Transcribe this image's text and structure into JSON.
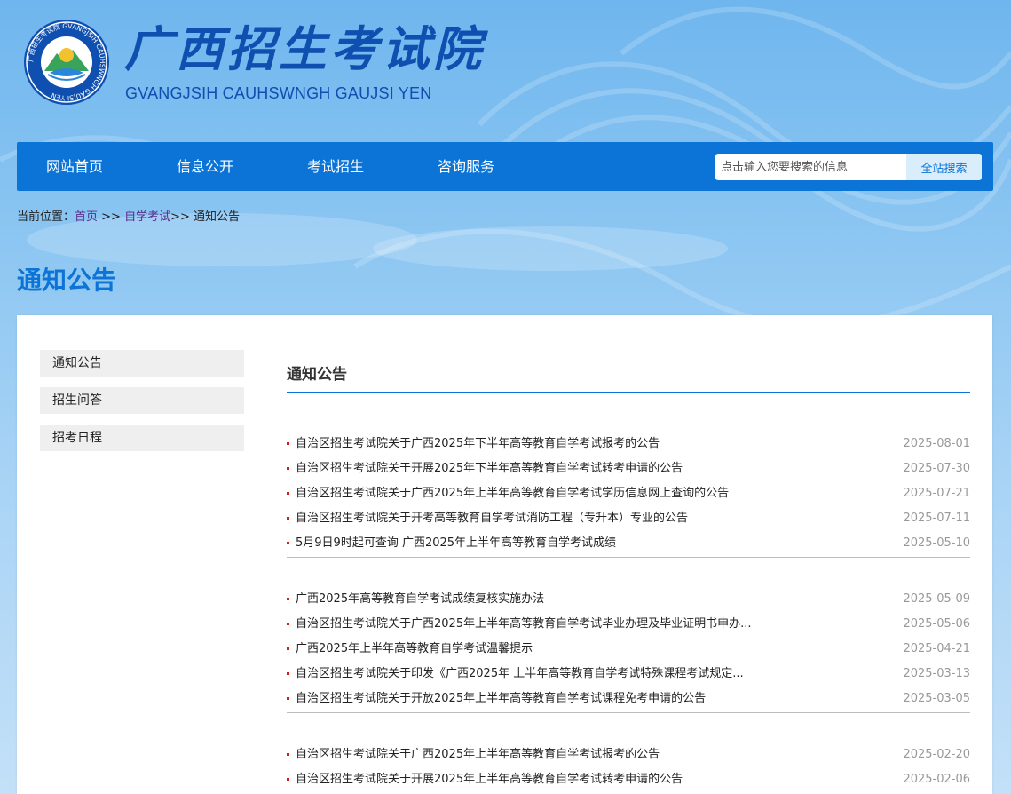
{
  "header": {
    "brand_cn": "广西招生考试院",
    "brand_en": "GVANGJSIH CAUHSWNGH GAUJSI YEN",
    "logo_ring_text": "广西招生考试院 GVANGJSIH CAUHSWNGH GAUJSI YEN"
  },
  "nav": {
    "items": [
      {
        "label": "网站首页"
      },
      {
        "label": "信息公开"
      },
      {
        "label": "考试招生"
      },
      {
        "label": "咨询服务"
      }
    ],
    "search_placeholder": "点击输入您要搜索的信息",
    "search_button": "全站搜索"
  },
  "breadcrumb": {
    "prefix": "当前位置：",
    "home": "首页",
    "sep1": " >> ",
    "category": "自学考试",
    "sep2": ">> ",
    "current": "通知公告"
  },
  "page_title": "通知公告",
  "sidebar": {
    "items": [
      {
        "label": "通知公告"
      },
      {
        "label": "招生问答"
      },
      {
        "label": "招考日程"
      }
    ]
  },
  "main": {
    "title": "通知公告",
    "groups": [
      {
        "items": [
          {
            "title": "自治区招生考试院关于广西2025年下半年高等教育自学考试报考的公告",
            "date": "2025-08-01"
          },
          {
            "title": "自治区招生考试院关于开展2025年下半年高等教育自学考试转考申请的公告",
            "date": "2025-07-30"
          },
          {
            "title": "自治区招生考试院关于广西2025年上半年高等教育自学考试学历信息网上查询的公告",
            "date": "2025-07-21"
          },
          {
            "title": "自治区招生考试院关于开考高等教育自学考试消防工程（专升本）专业的公告",
            "date": "2025-07-11"
          },
          {
            "title": "5月9日9时起可查询 广西2025年上半年高等教育自学考试成绩",
            "date": "2025-05-10"
          }
        ]
      },
      {
        "items": [
          {
            "title": "广西2025年高等教育自学考试成绩复核实施办法",
            "date": "2025-05-09"
          },
          {
            "title": "自治区招生考试院关于广西2025年上半年高等教育自学考试毕业办理及毕业证明书申办...",
            "date": "2025-05-06"
          },
          {
            "title": "广西2025年上半年高等教育自学考试温馨提示",
            "date": "2025-04-21"
          },
          {
            "title": "自治区招生考试院关于印发《广西2025年 上半年高等教育自学考试特殊课程考试规定...",
            "date": "2025-03-13"
          },
          {
            "title": "自治区招生考试院关于开放2025年上半年高等教育自学考试课程免考申请的公告",
            "date": "2025-03-05"
          }
        ]
      },
      {
        "items": [
          {
            "title": "自治区招生考试院关于广西2025年上半年高等教育自学考试报考的公告",
            "date": "2025-02-20"
          },
          {
            "title": "自治区招生考试院关于开展2025年上半年高等教育自学考试转考申请的公告",
            "date": "2025-02-06"
          }
        ]
      }
    ]
  },
  "colors": {
    "nav_bg": "#0b74d6",
    "brand": "#0e4fb0",
    "bullet": "#c81e1e",
    "date": "#999999"
  },
  "icons": {
    "logo": "emblem-logo-icon",
    "bullet": "square-bullet-icon"
  }
}
